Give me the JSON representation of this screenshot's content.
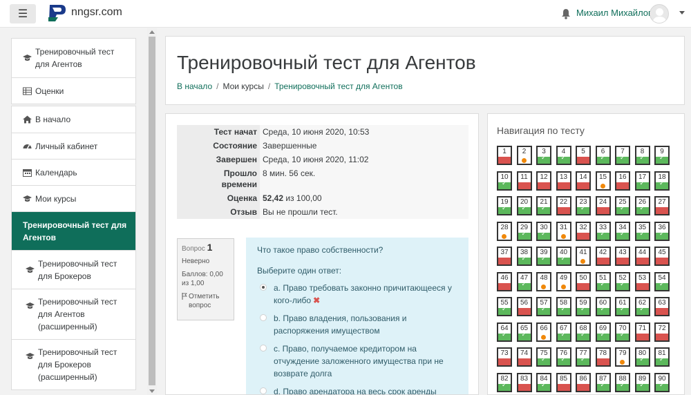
{
  "topbar": {
    "menu_icon": "menu-icon",
    "brand": "nngsr.com",
    "logo_text": "NGSR",
    "notifications_icon": "bell-icon",
    "user_name": "Михаил Михайлов"
  },
  "sidebar": {
    "groups": [
      [
        {
          "label": "Тренировочный тест для Агентов",
          "icon": "graduation-cap-icon"
        },
        {
          "label": "Оценки",
          "icon": "table-icon"
        }
      ],
      [
        {
          "label": "В начало",
          "icon": "home-icon"
        },
        {
          "label": "Личный кабинет",
          "icon": "dashboard-icon"
        },
        {
          "label": "Календарь",
          "icon": "calendar-icon"
        },
        {
          "label": "Мои курсы",
          "icon": "graduation-cap-icon"
        },
        {
          "label": "Тренировочный тест для Агентов",
          "active": true
        },
        {
          "label": "Тренировочный тест для Брокеров",
          "icon": "graduation-cap-icon"
        },
        {
          "label": "Тренировочный тест для Агентов (расширенный)",
          "icon": "graduation-cap-icon"
        },
        {
          "label": "Тренировочный тест для Брокеров (расширенный)",
          "icon": "graduation-cap-icon"
        }
      ]
    ]
  },
  "header": {
    "title": "Тренировочный тест для Агентов",
    "breadcrumb": [
      "В начало",
      "Мои курсы",
      "Тренировочный тест для Агентов"
    ]
  },
  "summary": [
    {
      "key": "Тест начат",
      "value": "Среда, 10 июня 2020, 10:53"
    },
    {
      "key": "Состояние",
      "value": "Завершенные"
    },
    {
      "key": "Завершен",
      "value": "Среда, 10 июня 2020, 11:02"
    },
    {
      "key": "Прошло времени",
      "value": "8 мин. 56 сек."
    },
    {
      "key": "Оценка",
      "value_bold": "52,42",
      "value_rest": " из 100,00"
    },
    {
      "key": "Отзыв",
      "value": "Вы не прошли тест."
    }
  ],
  "question_info": {
    "label": "Вопрос",
    "number": "1",
    "status": "Неверно",
    "score": "Баллов: 0,00 из 1,00",
    "flag_label": "Отметить вопрос",
    "flag_icon": "flag-icon"
  },
  "question": {
    "text": "Что такое право собственности?",
    "prompt": "Выберите один ответ:",
    "options": [
      {
        "text": "a. Право требовать законно причитающееся у кого-либо",
        "selected": true,
        "wrong_mark": "✖"
      },
      {
        "text": "b. Право владения, пользования и распоряжения имуществом"
      },
      {
        "text": "c. Право, получаемое кредитором на отчуждение заложенного имущества при не возврате долга"
      },
      {
        "text": "d. Право арендатора на весь срок аренды"
      }
    ]
  },
  "navigation": {
    "title": "Навигация по тесту",
    "states": [
      "w",
      "p",
      "c",
      "c",
      "w",
      "c",
      "c",
      "c",
      "c",
      "c",
      "w",
      "w",
      "w",
      "w",
      "p",
      "w",
      "c",
      "c",
      "c",
      "c",
      "c",
      "w",
      "c",
      "w",
      "c",
      "c",
      "w",
      "p",
      "c",
      "c",
      "p",
      "w",
      "c",
      "c",
      "c",
      "c",
      "w",
      "c",
      "c",
      "c",
      "p",
      "w",
      "w",
      "w",
      "w",
      "w",
      "c",
      "p",
      "p",
      "w",
      "c",
      "c",
      "w",
      "c",
      "c",
      "w",
      "c",
      "c",
      "c",
      "c",
      "c",
      "c",
      "w",
      "c",
      "c",
      "p",
      "c",
      "c",
      "c",
      "c",
      "w",
      "w",
      "w",
      "w",
      "c",
      "c",
      "c",
      "w",
      "p",
      "c",
      "c",
      "c",
      "w",
      "c",
      "w",
      "w",
      "c",
      "c",
      "c",
      "c"
    ],
    "colors": {
      "correct": "#5cb85c",
      "wrong": "#d9534f",
      "partial": "#f0880a"
    }
  }
}
